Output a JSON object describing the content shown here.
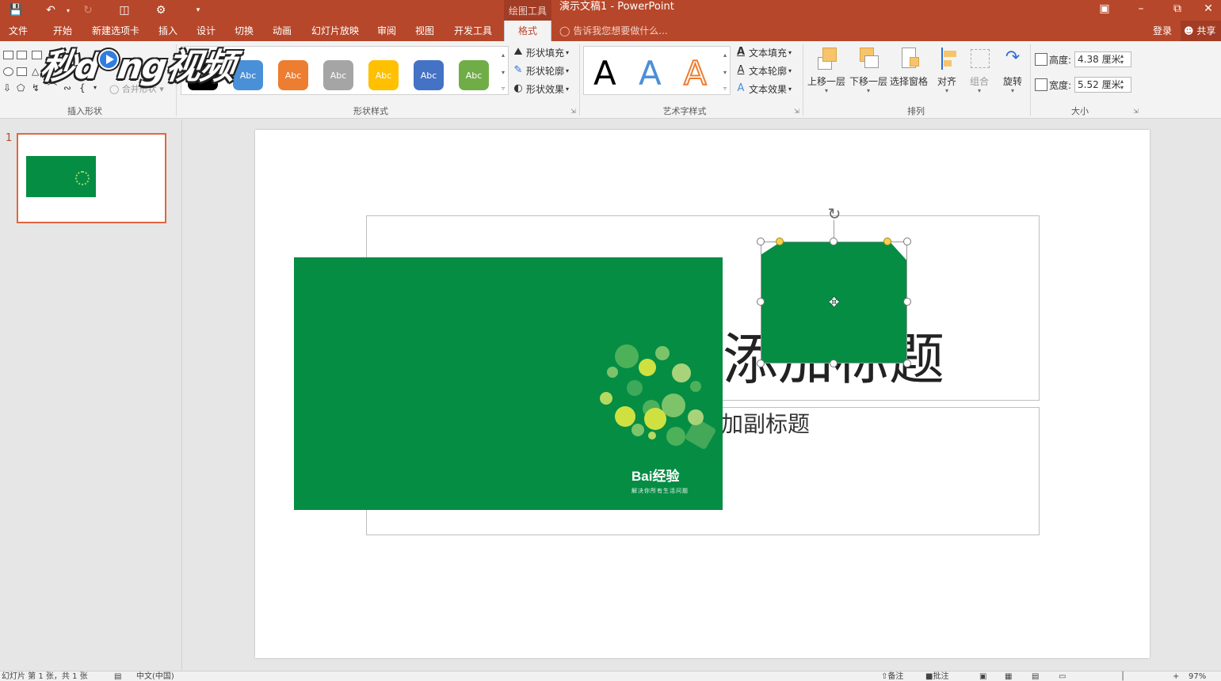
{
  "titlebar": {
    "context_tab": "绘图工具",
    "title": "演示文稿1 - PowerPoint"
  },
  "tabs": [
    {
      "label": "文件",
      "name": "tab-file"
    },
    {
      "label": "开始",
      "name": "tab-home"
    },
    {
      "label": "新建选项卡",
      "name": "tab-new"
    },
    {
      "label": "插入",
      "name": "tab-insert"
    },
    {
      "label": "设计",
      "name": "tab-design"
    },
    {
      "label": "切换",
      "name": "tab-transitions"
    },
    {
      "label": "动画",
      "name": "tab-animations"
    },
    {
      "label": "幻灯片放映",
      "name": "tab-slideshow"
    },
    {
      "label": "审阅",
      "name": "tab-review"
    },
    {
      "label": "视图",
      "name": "tab-view"
    },
    {
      "label": "开发工具",
      "name": "tab-developer"
    },
    {
      "label": "格式",
      "name": "tab-format"
    }
  ],
  "tellme": "告诉我您想要做什么...",
  "account": {
    "login": "登录",
    "share": "共享"
  },
  "ribbon": {
    "insert_shapes": {
      "label": "插入形状",
      "merge": "合并形状"
    },
    "shape_styles": {
      "label": "形状样式",
      "swatch_text": "Abc",
      "swatches": [
        "#000000",
        "#4a90d9",
        "#ed7d31",
        "#a5a5a5",
        "#ffc000",
        "#4472c4",
        "#70ad47"
      ],
      "fill": "形状填充",
      "outline": "形状轮廓",
      "effects": "形状效果"
    },
    "wordart": {
      "label": "艺术字样式",
      "letter": "A",
      "text_fill": "文本填充",
      "text_outline": "文本轮廓",
      "text_effects": "文本效果"
    },
    "arrange": {
      "label": "排列",
      "bring_forward": "上移一层",
      "send_backward": "下移一层",
      "selection_pane": "选择窗格",
      "align": "对齐",
      "group": "组合",
      "rotate": "旋转"
    },
    "size": {
      "label": "大小",
      "height_label": "高度:",
      "height_value": "4.38 厘米",
      "width_label": "宽度:",
      "width_value": "5.52 厘米"
    }
  },
  "watermark": {
    "part1": "秒d",
    "part2": "ng视频"
  },
  "thumbnails": {
    "slide_number": "1"
  },
  "slide": {
    "title_text": "添加标题",
    "subtitle_text": "加副标题",
    "image": {
      "brand": "Bai经验",
      "brand_sub": "解决你所有生活问题"
    }
  },
  "statusbar": {
    "slide_info": "幻灯片 第 1 张，共 1 张",
    "language": "中文(中国)",
    "notes": "备注",
    "comments": "批注",
    "zoom": "97%"
  },
  "colors": {
    "accent": "#b7472a",
    "slide_green": "#058d44"
  }
}
